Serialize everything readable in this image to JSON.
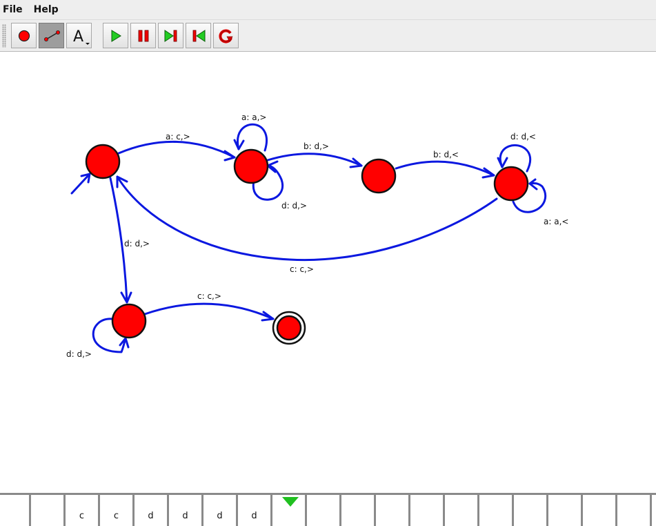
{
  "menubar": {
    "items": [
      "File",
      "Help"
    ]
  },
  "toolbar": {
    "buttons": [
      {
        "name": "add-state-tool",
        "icon": "red-circle-icon",
        "pressed": false
      },
      {
        "name": "add-transition-tool",
        "icon": "transition-line-icon",
        "pressed": true
      },
      {
        "name": "text-tool",
        "icon": "text-a-icon",
        "pressed": false,
        "text": "A"
      },
      {
        "name": "run-button",
        "icon": "play-icon",
        "pressed": false
      },
      {
        "name": "pause-button",
        "icon": "pause-icon",
        "pressed": false
      },
      {
        "name": "step-forward-button",
        "icon": "step-forward-icon",
        "pressed": false
      },
      {
        "name": "step-back-button",
        "icon": "step-back-icon",
        "pressed": false
      },
      {
        "name": "reset-button",
        "icon": "reset-icon",
        "pressed": false
      }
    ]
  },
  "machine": {
    "state_color": "#ff0000",
    "edge_color": "#0b18e0",
    "transitions": [
      {
        "label": "a: c,>"
      },
      {
        "label": "a: a,>"
      },
      {
        "label": "d: d,>"
      },
      {
        "label": "b: d,>"
      },
      {
        "label": "b: d,<"
      },
      {
        "label": "d: d,<"
      },
      {
        "label": "a: a,<"
      },
      {
        "label": "c: c,>"
      },
      {
        "label": "d: d,>"
      },
      {
        "label": "d: d,>"
      },
      {
        "label": "c: c,>"
      }
    ]
  },
  "tape": {
    "cells": [
      "",
      "",
      "c",
      "c",
      "d",
      "d",
      "d",
      "d",
      "",
      "",
      "",
      "",
      "",
      "",
      "",
      "",
      "",
      "",
      "",
      ""
    ],
    "head_index": 8,
    "head_color": "#20c020"
  }
}
